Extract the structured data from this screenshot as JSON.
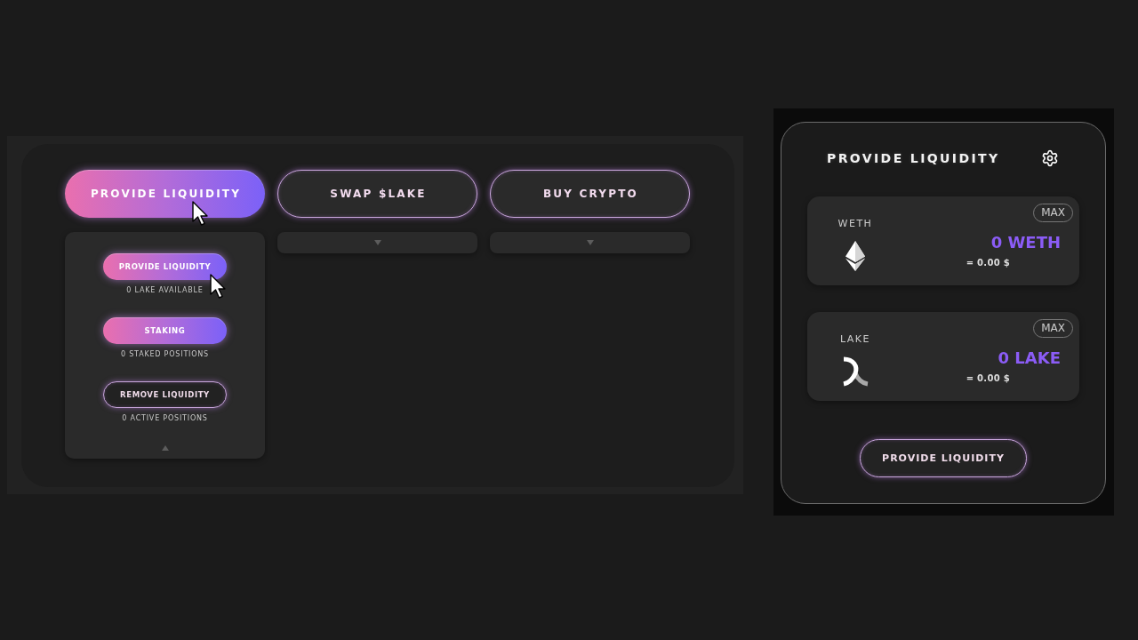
{
  "tabs": [
    {
      "label": "PROVIDE LIQUIDITY",
      "selected": true,
      "expanded": true,
      "actions": [
        {
          "label": "PROVIDE LIQUIDITY",
          "kind": "filled",
          "caption": "0 LAKE AVAILABLE"
        },
        {
          "label": "STAKING",
          "kind": "filled",
          "caption": "0 STAKED POSITIONS"
        },
        {
          "label": "REMOVE LIQUIDITY",
          "kind": "outline",
          "caption": "0 ACTIVE POSITIONS"
        }
      ]
    },
    {
      "label": "SWAP $LAKE",
      "selected": false,
      "expanded": false
    },
    {
      "label": "BUY CRYPTO",
      "selected": false,
      "expanded": false
    }
  ],
  "liquidity_card": {
    "title": "PROVIDE LIQUIDITY",
    "tokens": [
      {
        "symbol": "WETH",
        "kind": "eth",
        "amount": "0 WETH",
        "usd_value": "= 0.00 $",
        "max_label": "MAX"
      },
      {
        "symbol": "LAKE",
        "kind": "lake",
        "amount": "0 LAKE",
        "usd_value": "= 0.00 $",
        "max_label": "MAX"
      }
    ],
    "submit_label": "PROVIDE LIQUIDITY"
  }
}
